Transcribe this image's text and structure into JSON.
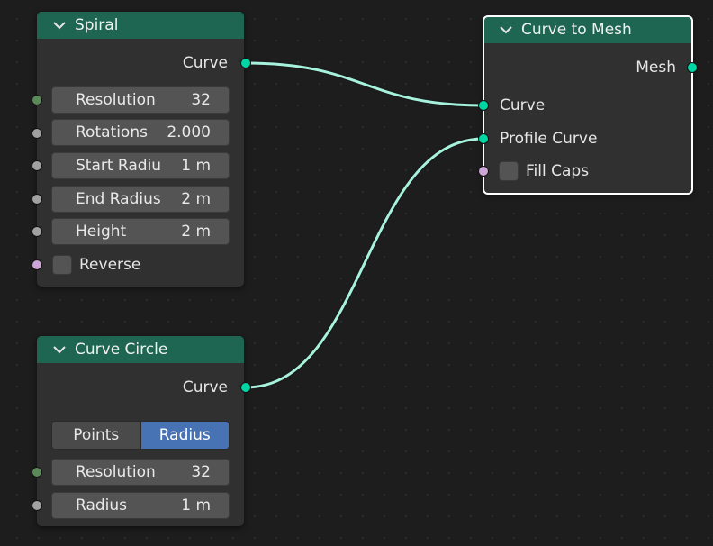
{
  "colors": {
    "header": "#1e6652",
    "geometry_socket": "#00d6a3",
    "int_socket": "#5a8a5a",
    "float_socket": "#a1a1a1",
    "bool_socket": "#cca6d6",
    "link": "#a6f2dc",
    "segment_active": "#4772b3"
  },
  "spiral": {
    "title": "Spiral",
    "output": "Curve",
    "fields": [
      {
        "label": "Resolution",
        "value": "32"
      },
      {
        "label": "Rotations",
        "value": "2.000"
      },
      {
        "label": "Start Radiu",
        "value": "1 m"
      },
      {
        "label": "End Radius",
        "value": "2 m"
      },
      {
        "label": "Height",
        "value": "2 m"
      }
    ],
    "reverse_label": "Reverse"
  },
  "curve_circle": {
    "title": "Curve Circle",
    "output": "Curve",
    "mode_options": [
      "Points",
      "Radius"
    ],
    "mode_selected": "Radius",
    "fields": [
      {
        "label": "Resolution",
        "value": "32"
      },
      {
        "label": "Radius",
        "value": "1 m"
      }
    ]
  },
  "curve_to_mesh": {
    "title": "Curve to Mesh",
    "output": "Mesh",
    "inputs": [
      "Curve",
      "Profile Curve"
    ],
    "fill_caps_label": "Fill Caps"
  }
}
